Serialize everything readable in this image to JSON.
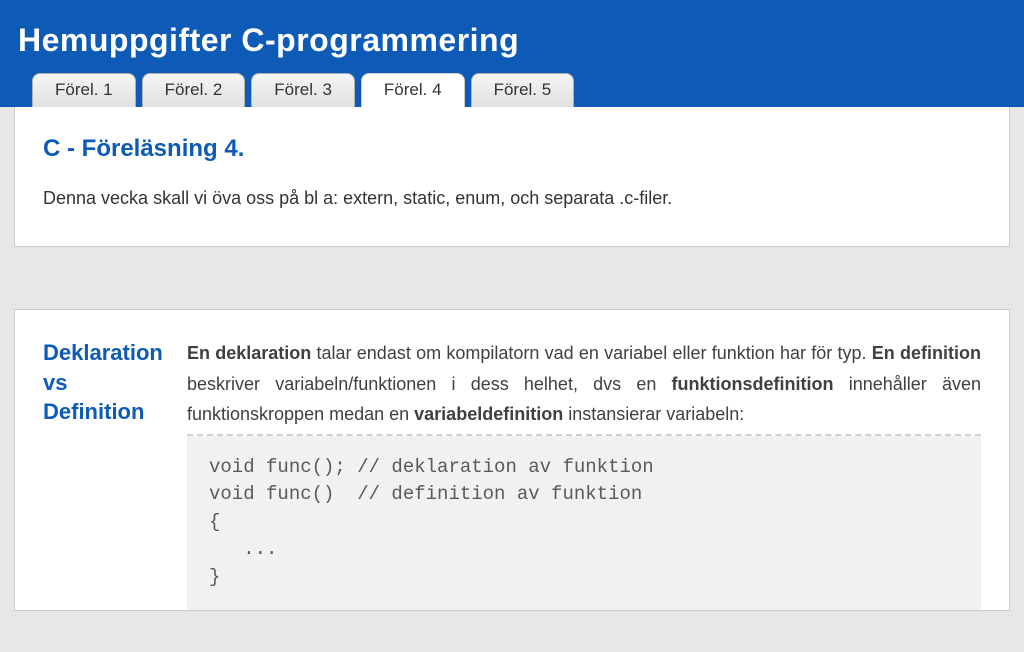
{
  "header": {
    "title": "Hemuppgifter C-programmering"
  },
  "tabs": [
    {
      "label": "Förel. 1",
      "active": false
    },
    {
      "label": "Förel. 2",
      "active": false
    },
    {
      "label": "Förel. 3",
      "active": false
    },
    {
      "label": "Förel. 4",
      "active": true
    },
    {
      "label": "Förel. 5",
      "active": false
    }
  ],
  "intro": {
    "heading": "C - Föreläsning 4.",
    "text": "Denna vecka skall vi öva oss på bl a: extern, static, enum, och separata .c-filer."
  },
  "section": {
    "title": "Deklara­tion vs Definition",
    "para_parts": {
      "t0": "En deklaration",
      "t1": " talar endast om kompilatorn vad en variabel eller funktion har för typ. ",
      "t2": "En definition",
      "t3": " beskriver variabeln/funktionen i dess helhet, dvs en ",
      "t4": "funktionsdefinition",
      "t5": " innehåller även funktionskroppen medan en ",
      "t6": "variabeldefinition",
      "t7": " instansierar variabeln:"
    },
    "code": "void func(); // deklaration av funktion\nvoid func()  // definition av funktion\n{\n   ...\n}"
  }
}
